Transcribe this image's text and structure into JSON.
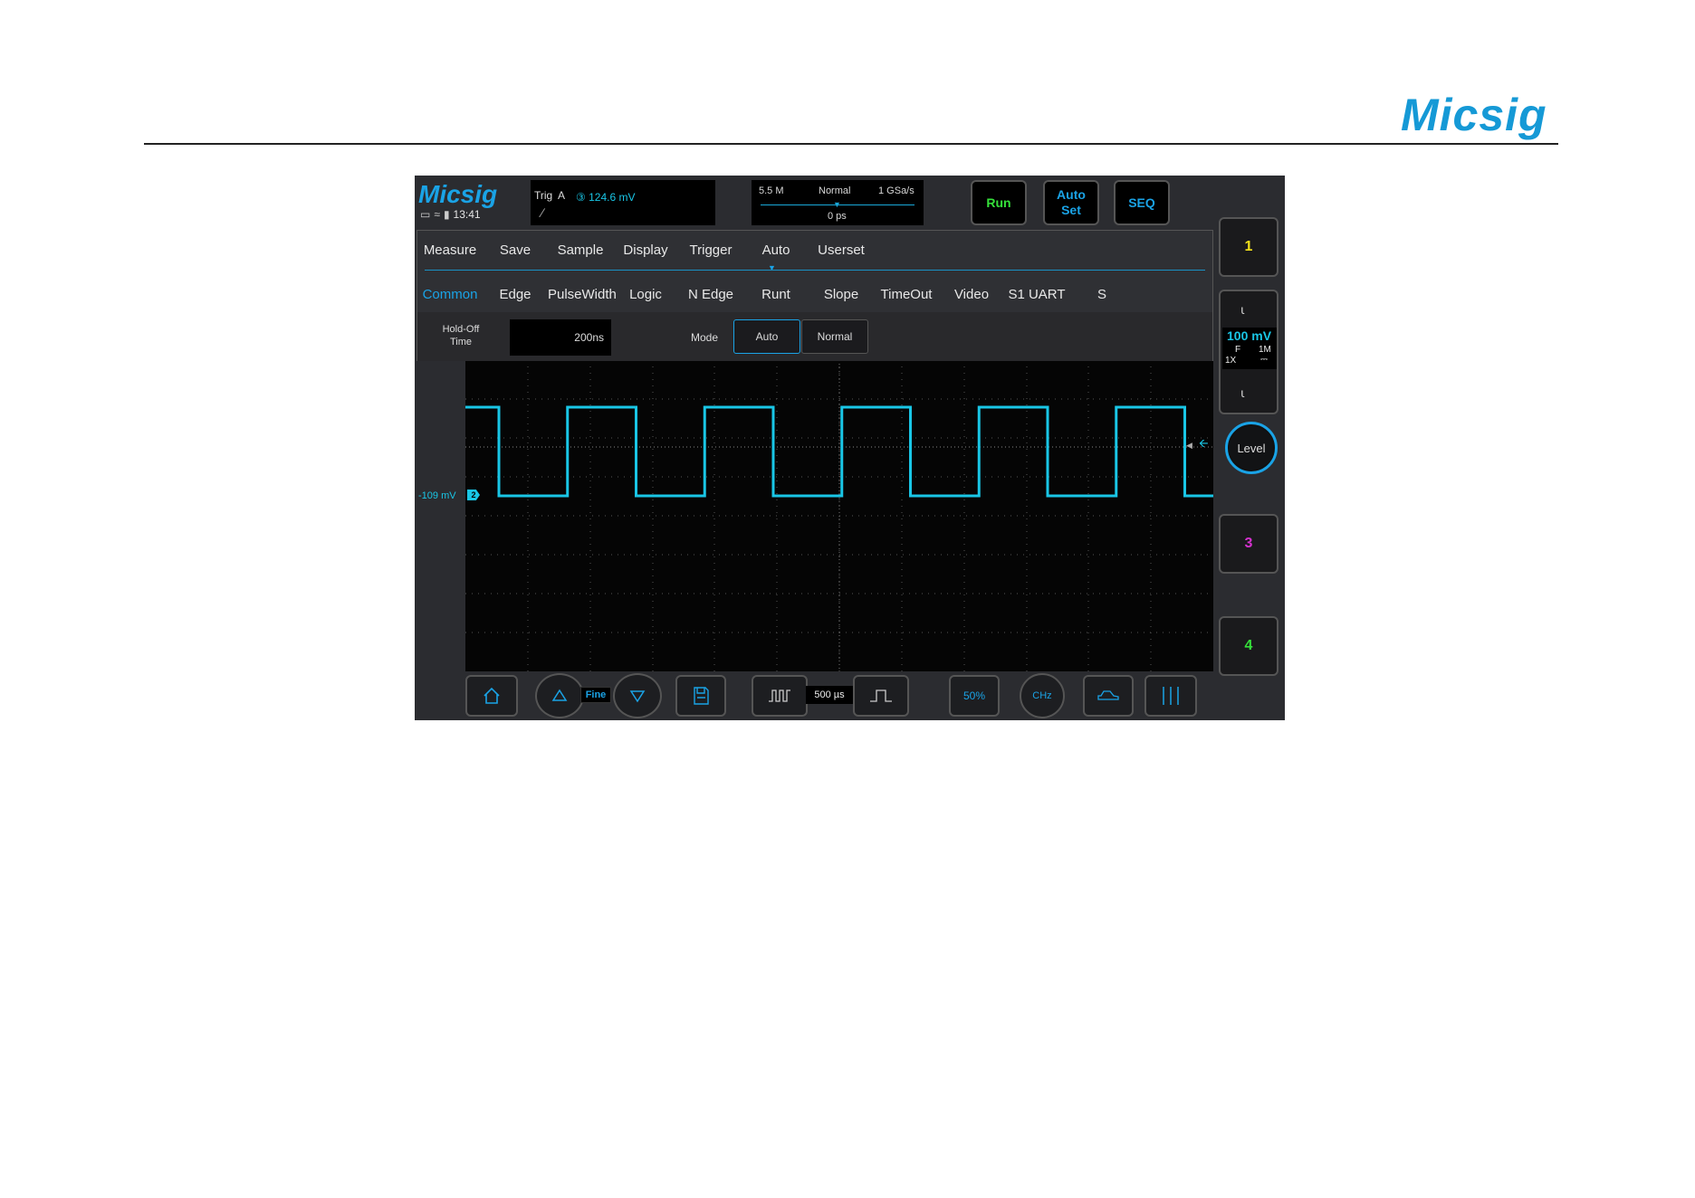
{
  "document": {
    "brand": "Micsig"
  },
  "scope": {
    "logo": "Micsig",
    "status": {
      "time": "13:41",
      "icons": [
        "display-icon",
        "wifi-icon",
        "battery-icon"
      ]
    },
    "trigger": {
      "label": "Trig",
      "source": "A",
      "level": "③ 124.6  mV",
      "edge_glyph": "∕"
    },
    "timebase": {
      "memory": "5.5 M",
      "mode": "Normal",
      "sample_rate": "1 GSa/s",
      "position": "0 ps"
    },
    "buttons": {
      "run": "Run",
      "autoset_line1": "Auto",
      "autoset_line2": "Set",
      "seq": "SEQ"
    },
    "menu": {
      "tabs": [
        "Measure",
        "Save",
        "Sample",
        "Display",
        "Trigger",
        "Auto",
        "Userset"
      ],
      "active_tab": "Trigger",
      "trigger_types": [
        "Common",
        "Edge",
        "PulseWidth",
        "Logic",
        "N Edge",
        "Runt",
        "Slope",
        "TimeOut",
        "Video",
        "S1 UART",
        "S"
      ],
      "active_type": "Common",
      "holdoff_label_line1": "Hold-Off",
      "holdoff_label_line2": "Time",
      "holdoff_value": "200ns",
      "mode_label": "Mode",
      "mode_options": [
        "Auto",
        "Normal"
      ],
      "mode_selected": "Auto"
    },
    "channel_offset": "-109 mV",
    "channel_marker": "2",
    "channels": {
      "ch1": "1",
      "ch2": {
        "volts": "100 mV",
        "coupling": "F",
        "impedance": "1M",
        "probe": "1X",
        "dc_glyph": "⎓"
      },
      "ch3": "3",
      "ch4": "4",
      "level_button": "Level"
    },
    "toolbar": {
      "fine": "Fine",
      "time_div": "500 µs",
      "icons": [
        "home-icon",
        "up-arrow-icon",
        "down-arrow-icon",
        "save-icon",
        "narrow-pulse-icon",
        "wide-pulse-icon",
        "percent-icon",
        "hz-icon",
        "car-icon",
        "cursor-lines-icon"
      ]
    },
    "colors": {
      "accent": "#1aa3e6",
      "trace_ch2": "#19c6e6",
      "run_green": "#35e03a",
      "ch1_yellow": "#f5e21a",
      "ch3_magenta": "#d632d0",
      "ch4_green": "#35e03a"
    },
    "waveform": {
      "channel": 2,
      "shape": "square",
      "high_px_note": "",
      "cycles_visible": 5.5
    }
  }
}
